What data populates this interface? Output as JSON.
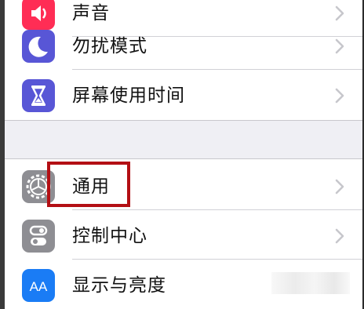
{
  "settings": {
    "top_group": [
      {
        "label": "声音",
        "icon": "sound-icon",
        "color": "#ff2d55"
      },
      {
        "label": "勿扰模式",
        "icon": "moon-icon",
        "color": "#5856d6"
      },
      {
        "label": "屏幕使用时间",
        "icon": "hourglass-icon",
        "color": "#5856d6"
      }
    ],
    "bottom_group": [
      {
        "label": "通用",
        "icon": "gear-icon",
        "color": "#8e8e93"
      },
      {
        "label": "控制中心",
        "icon": "toggles-icon",
        "color": "#8e8e93"
      },
      {
        "label": "显示与亮度",
        "icon": "display-icon",
        "color": "#1a7cf5",
        "icon_text": "AA"
      }
    ]
  },
  "highlight_color": "#b30f14"
}
